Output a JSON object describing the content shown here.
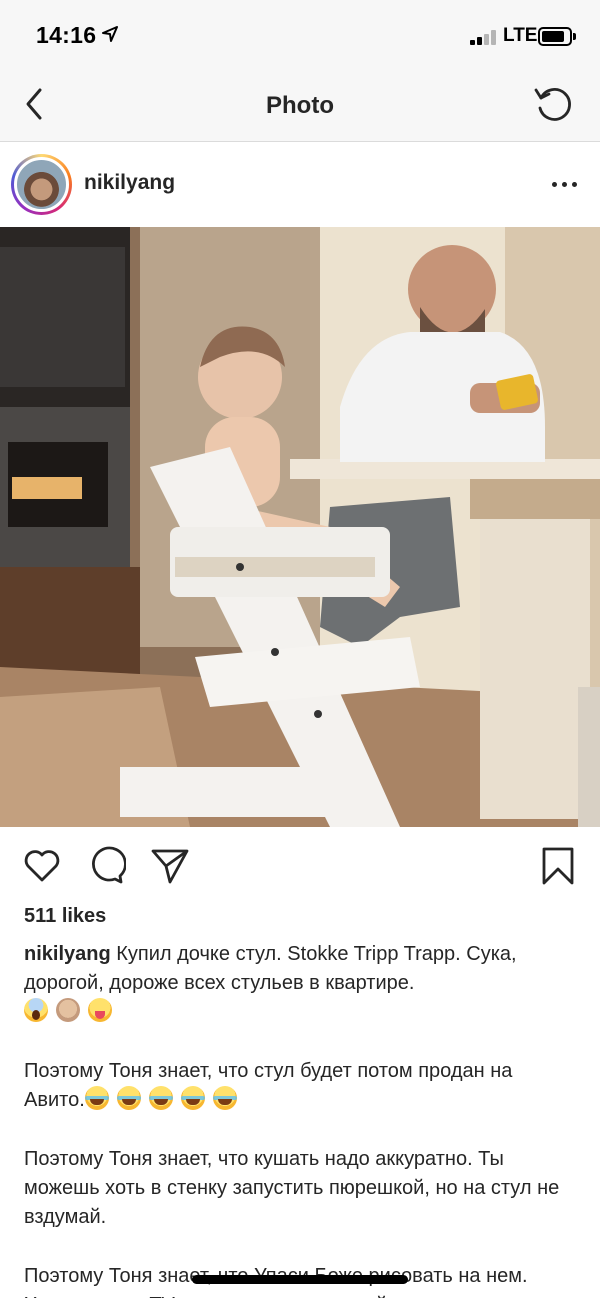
{
  "status_bar": {
    "time": "14:16",
    "network": "LTE",
    "location_icon": "location-arrow-icon",
    "signal_icon": "cell-signal-icon",
    "battery_icon": "battery-icon"
  },
  "nav": {
    "title": "Photo",
    "back_icon": "chevron-left-icon",
    "refresh_icon": "refresh-icon"
  },
  "post": {
    "username": "nikilyang",
    "more_icon": "more-horizontal-icon",
    "likes": "511 likes",
    "caption": {
      "username": "nikilyang",
      "line1": " Купил дочке стул.  Stokke Tripp Trapp. Сука, дорогой, дороже всех стульев в квартире.",
      "para2": "Поэтому Тоня знает, что стул будет потом продан на Авито.",
      "para3": "Поэтому Тоня знает, что кушать надо аккуратно. Ты можешь хоть в стенку запустить пюрешкой, но на стул не вздумай.",
      "para4": "Поэтому Тоня знает, что Упаси Боже рисовать на нем. Хоть гуашь в TV же стенку с пюрешкой"
    }
  },
  "actions": {
    "like_icon": "heart-icon",
    "comment_icon": "comment-icon",
    "share_icon": "send-icon",
    "save_icon": "bookmark-icon"
  },
  "colors": {
    "bar_bg": "#f7f7f7",
    "text": "#262626",
    "divider": "#dbdbdb"
  }
}
